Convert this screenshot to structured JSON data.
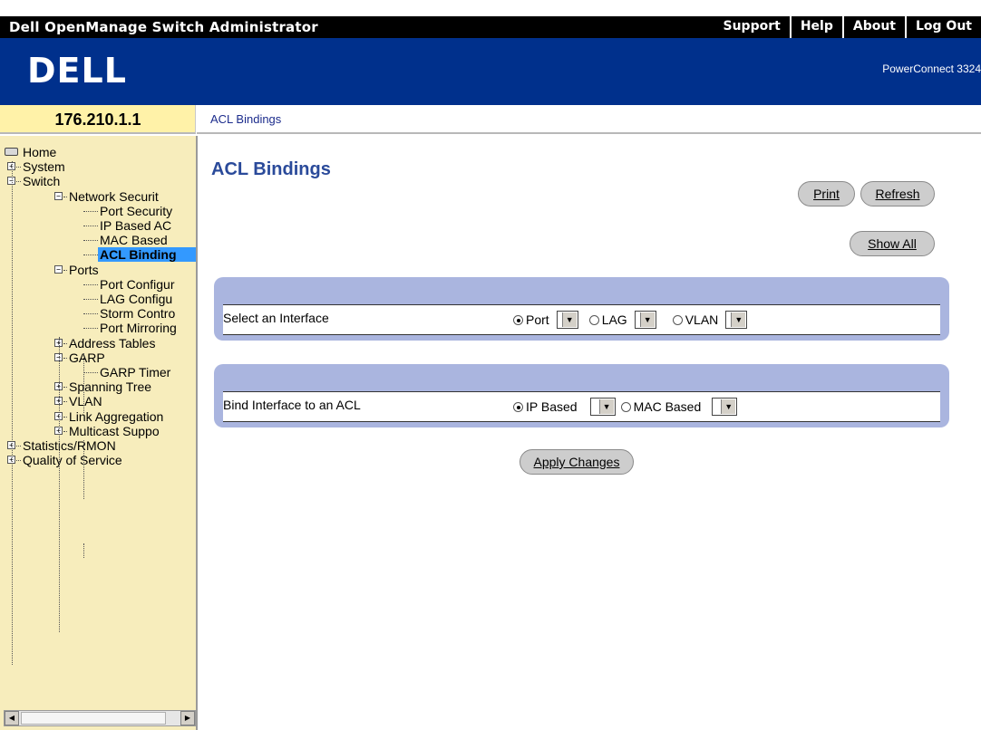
{
  "header": {
    "app_title": "Dell OpenManage Switch Administrator",
    "links": [
      "Support",
      "Help",
      "About",
      "Log Out"
    ],
    "logo": "DELL",
    "model": "PowerConnect 3324"
  },
  "device_ip": "176.210.1.1",
  "breadcrumb": "ACL Bindings",
  "tree": {
    "items": [
      {
        "label": "Home",
        "level": 0,
        "expander": "none",
        "selected": false
      },
      {
        "label": "System",
        "level": 1,
        "expander": "plus",
        "selected": false
      },
      {
        "label": "Switch",
        "level": 1,
        "expander": "minus",
        "selected": false
      },
      {
        "label": "Network Securit",
        "level": 2,
        "expander": "minus",
        "selected": false
      },
      {
        "label": "Port Security",
        "level": 3,
        "expander": "none",
        "selected": false
      },
      {
        "label": "IP Based AC",
        "level": 3,
        "expander": "none",
        "selected": false
      },
      {
        "label": "MAC Based",
        "level": 3,
        "expander": "none",
        "selected": false
      },
      {
        "label": "ACL Binding",
        "level": 3,
        "expander": "none",
        "selected": true
      },
      {
        "label": "Ports",
        "level": 2,
        "expander": "minus",
        "selected": false
      },
      {
        "label": "Port Configur",
        "level": 3,
        "expander": "none",
        "selected": false
      },
      {
        "label": "LAG Configu",
        "level": 3,
        "expander": "none",
        "selected": false
      },
      {
        "label": "Storm Contro",
        "level": 3,
        "expander": "none",
        "selected": false
      },
      {
        "label": "Port Mirroring",
        "level": 3,
        "expander": "none",
        "selected": false
      },
      {
        "label": "Address Tables",
        "level": 2,
        "expander": "plus",
        "selected": false
      },
      {
        "label": "GARP",
        "level": 2,
        "expander": "minus",
        "selected": false
      },
      {
        "label": "GARP Timer",
        "level": 3,
        "expander": "none",
        "selected": false
      },
      {
        "label": "Spanning Tree",
        "level": 2,
        "expander": "plus",
        "selected": false
      },
      {
        "label": "VLAN",
        "level": 2,
        "expander": "plus",
        "selected": false
      },
      {
        "label": "Link Aggregation",
        "level": 2,
        "expander": "plus",
        "selected": false
      },
      {
        "label": "Multicast Suppo",
        "level": 2,
        "expander": "plus",
        "selected": false
      },
      {
        "label": "Statistics/RMON",
        "level": 1,
        "expander": "plus",
        "selected": false
      },
      {
        "label": "Quality of Service",
        "level": 1,
        "expander": "plus",
        "selected": false
      }
    ]
  },
  "main": {
    "title": "ACL Bindings",
    "buttons": {
      "print": "Print",
      "refresh": "Refresh",
      "show_all": "Show All",
      "apply": "Apply Changes"
    },
    "interface_row": {
      "label": "Select an Interface",
      "options": [
        {
          "label": "Port",
          "checked": true
        },
        {
          "label": "LAG",
          "checked": false
        },
        {
          "label": "VLAN",
          "checked": false
        }
      ]
    },
    "bind_row": {
      "label": "Bind Interface to an ACL",
      "options": [
        {
          "label": "IP Based",
          "checked": true
        },
        {
          "label": "MAC Based",
          "checked": false
        }
      ]
    }
  },
  "icons": {
    "tree_home": "home-icon",
    "expand": "plus-icon",
    "collapse": "minus-icon",
    "dropdown": "chevron-down-icon",
    "scroll_left": "arrow-left-icon",
    "scroll_right": "arrow-right-icon"
  },
  "colors": {
    "title_bar": "#000000",
    "banner": "#00308c",
    "ip_bar": "#fff2a8",
    "sidebar": "#f7edbc",
    "selection": "#3399ff",
    "panel": "#aab5df",
    "page_title": "#2a4a9a"
  }
}
